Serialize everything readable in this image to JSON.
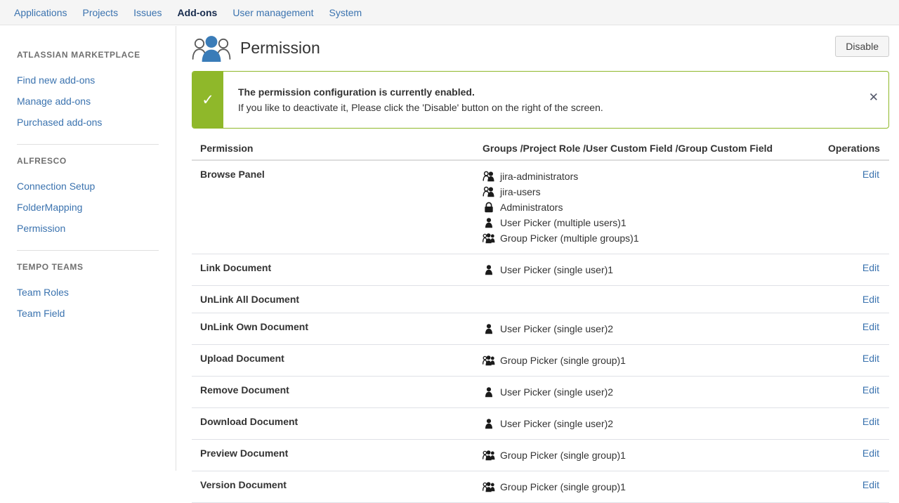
{
  "topnav": {
    "tabs": [
      {
        "label": "Applications",
        "active": false
      },
      {
        "label": "Projects",
        "active": false
      },
      {
        "label": "Issues",
        "active": false
      },
      {
        "label": "Add-ons",
        "active": true
      },
      {
        "label": "User management",
        "active": false
      },
      {
        "label": "System",
        "active": false
      }
    ]
  },
  "sidebar": {
    "groups": [
      {
        "heading": "ATLASSIAN MARKETPLACE",
        "items": [
          {
            "label": "Find new add-ons"
          },
          {
            "label": "Manage add-ons"
          },
          {
            "label": "Purchased add-ons"
          }
        ]
      },
      {
        "heading": "ALFRESCO",
        "items": [
          {
            "label": "Connection Setup"
          },
          {
            "label": "FolderMapping"
          },
          {
            "label": "Permission"
          }
        ]
      },
      {
        "heading": "TEMPO TEAMS",
        "items": [
          {
            "label": "Team Roles"
          },
          {
            "label": "Team Field"
          }
        ]
      }
    ]
  },
  "header": {
    "icon": "people-group-icon",
    "title": "Permission",
    "disable_label": "Disable"
  },
  "banner": {
    "status_icon": "check-icon",
    "title": "The permission configuration is currently enabled.",
    "subtitle": "If you like to deactivate it, Please click the 'Disable' button on the right of the screen.",
    "close_label": "✕",
    "accent_color": "#8fb82a"
  },
  "table": {
    "columns": [
      "Permission",
      "Groups /Project Role /User Custom Field /Group Custom Field",
      "Operations"
    ],
    "edit_label": "Edit",
    "rows": [
      {
        "permission": "Browse Panel",
        "grants": [
          {
            "icon": "group-icon",
            "label": "jira-administrators"
          },
          {
            "icon": "group-icon",
            "label": "jira-users"
          },
          {
            "icon": "lock-icon",
            "label": "Administrators"
          },
          {
            "icon": "user-icon",
            "label": "User Picker (multiple users)1"
          },
          {
            "icon": "group-multi-icon",
            "label": "Group Picker (multiple groups)1"
          }
        ]
      },
      {
        "permission": "Link Document",
        "grants": [
          {
            "icon": "user-icon",
            "label": "User Picker (single user)1"
          }
        ]
      },
      {
        "permission": "UnLink All Document",
        "grants": []
      },
      {
        "permission": "UnLink Own Document",
        "grants": [
          {
            "icon": "user-icon",
            "label": "User Picker (single user)2"
          }
        ]
      },
      {
        "permission": "Upload Document",
        "grants": [
          {
            "icon": "group-multi-icon",
            "label": "Group Picker (single group)1"
          }
        ]
      },
      {
        "permission": "Remove Document",
        "grants": [
          {
            "icon": "user-icon",
            "label": "User Picker (single user)2"
          }
        ]
      },
      {
        "permission": "Download Document",
        "grants": [
          {
            "icon": "user-icon",
            "label": "User Picker (single user)2"
          }
        ]
      },
      {
        "permission": "Preview Document",
        "grants": [
          {
            "icon": "group-multi-icon",
            "label": "Group Picker (single group)1"
          }
        ]
      },
      {
        "permission": "Version Document",
        "grants": [
          {
            "icon": "group-multi-icon",
            "label": "Group Picker (single group)1"
          }
        ]
      }
    ]
  }
}
